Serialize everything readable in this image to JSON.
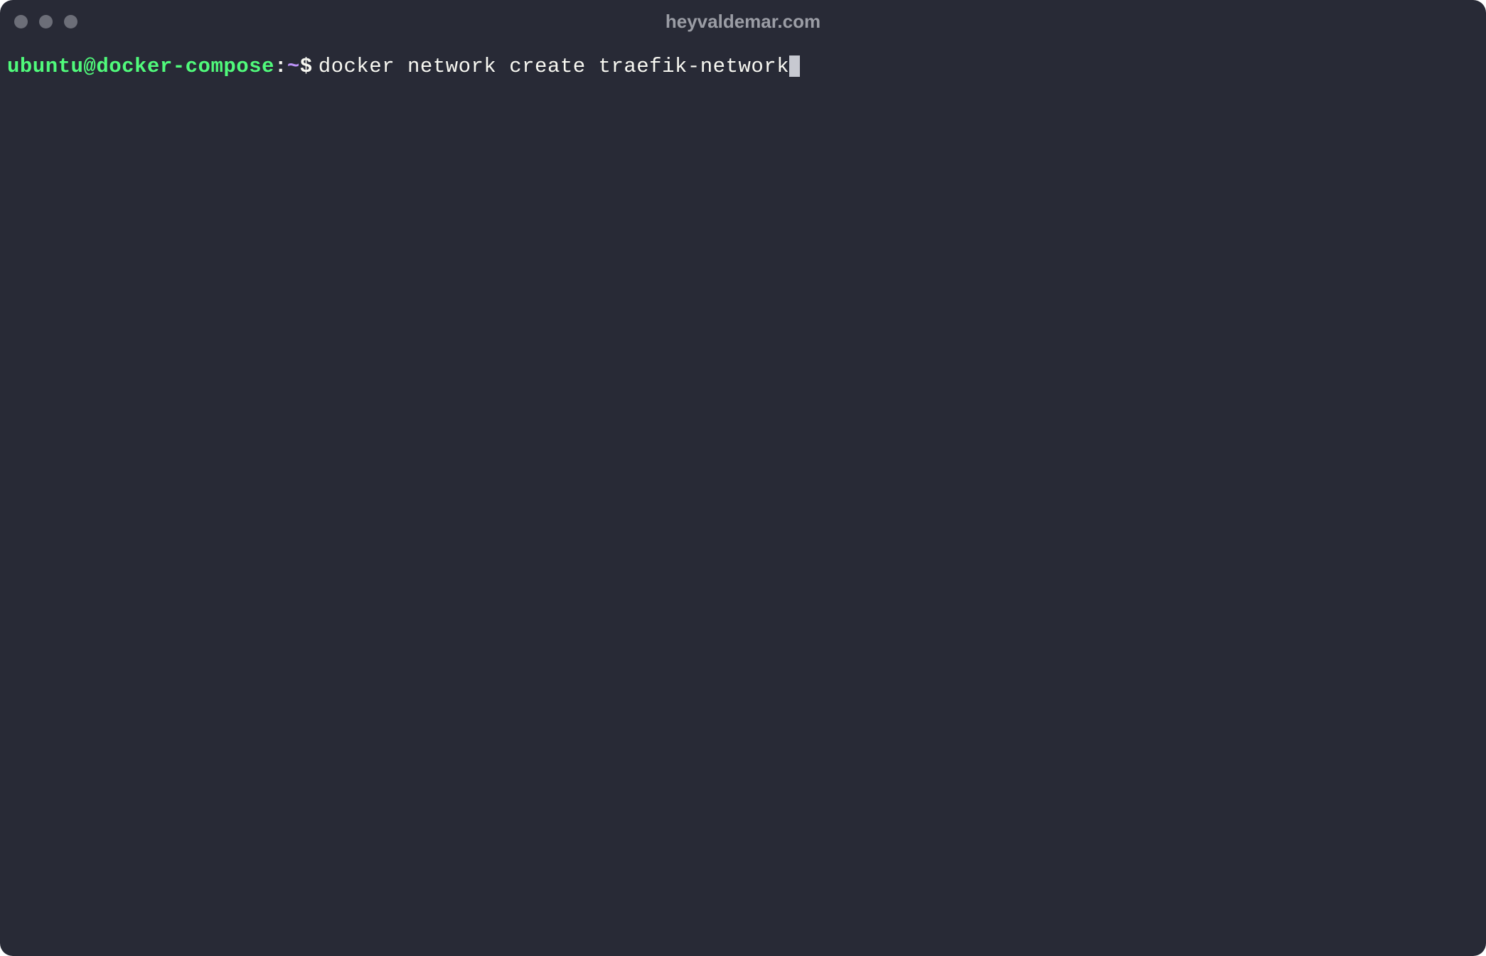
{
  "window": {
    "title": "heyvaldemar.com"
  },
  "prompt": {
    "user_host": "ubuntu@docker-compose",
    "colon": ":",
    "path": "~",
    "symbol": "$"
  },
  "command": "docker network create traefik-network",
  "colors": {
    "background": "#282a36",
    "foreground": "#f8f8f2",
    "prompt_user_host": "#50fa7b",
    "prompt_path": "#bd93f9",
    "title_text": "#9b9da5",
    "window_control": "#6c6e78",
    "cursor": "#c7c9d1"
  }
}
